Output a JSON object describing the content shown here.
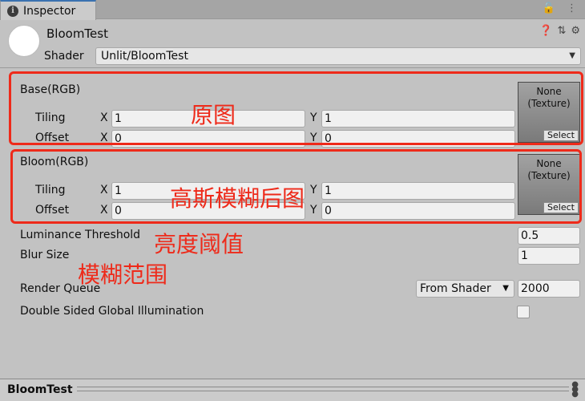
{
  "tab": {
    "title": "Inspector",
    "icons": [
      "lock-icon",
      "kebab-menu-icon"
    ]
  },
  "header": {
    "material_name": "BloomTest",
    "shader_label": "Shader",
    "shader_value": "Unlit/BloomTest",
    "icons": [
      "help-icon",
      "preset-icon",
      "gear-icon"
    ]
  },
  "base": {
    "label": "Base(RGB)",
    "tiling_label": "Tiling",
    "offset_label": "Offset",
    "x_label": "X",
    "y_label": "Y",
    "tiling_x": "1",
    "tiling_y": "1",
    "offset_x": "0",
    "offset_y": "0",
    "texture_none": "None\n(Texture)",
    "select_label": "Select"
  },
  "bloom": {
    "label": "Bloom(RGB)",
    "tiling_label": "Tiling",
    "offset_label": "Offset",
    "x_label": "X",
    "y_label": "Y",
    "tiling_x": "1",
    "tiling_y": "1",
    "offset_x": "0",
    "offset_y": "0",
    "texture_none": "None\n(Texture)",
    "select_label": "Select"
  },
  "properties": {
    "luminance_label": "Luminance Threshold",
    "luminance_value": "0.5",
    "blur_label": "Blur Size",
    "blur_value": "1",
    "render_queue_label": "Render Queue",
    "render_queue_mode": "From Shader",
    "render_queue_value": "2000",
    "double_sided_label": "Double Sided Global Illumination"
  },
  "annotations": {
    "base": "原图",
    "bloom": "高斯模糊后图",
    "luminance": "亮度阈值",
    "blur": "模糊范围"
  },
  "footer": {
    "name": "BloomTest"
  },
  "colors": {
    "annotation_red": "#ee2a1a",
    "tab_accent": "#3a72b0"
  }
}
